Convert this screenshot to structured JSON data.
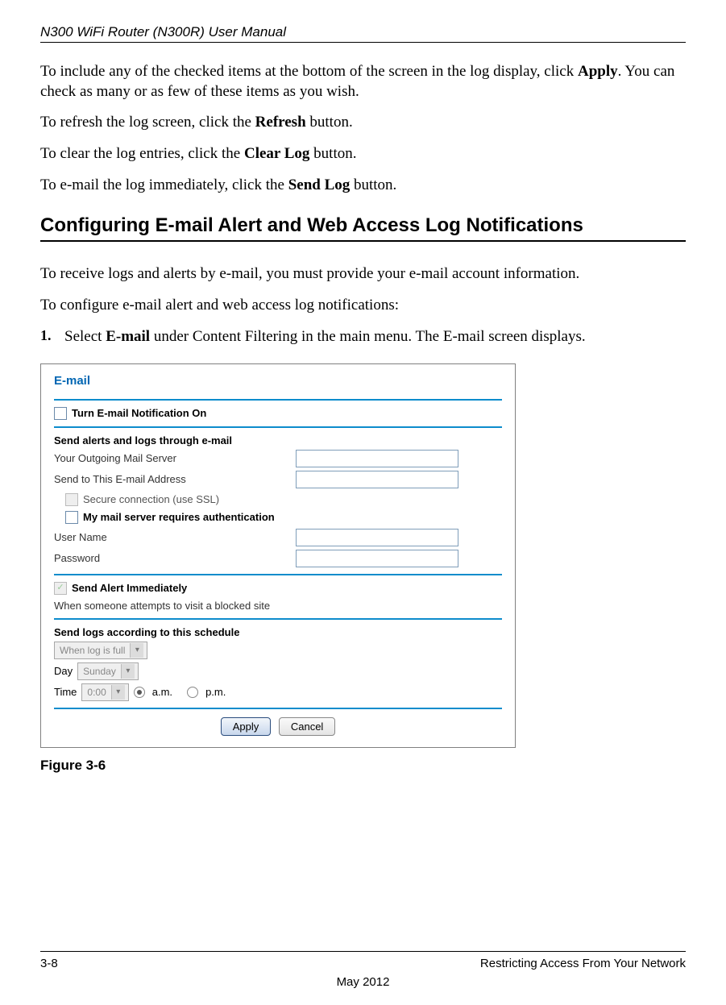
{
  "header": {
    "running_title": "N300 WiFi Router (N300R) User Manual"
  },
  "body": {
    "p1a": "To include any of the checked items at the bottom of the screen in the log display, click ",
    "p1b": "Apply",
    "p1c": ". You can check as many or as few of these items as you wish.",
    "p2a": "To refresh the log screen, click the ",
    "p2b": "Refresh",
    "p2c": " button.",
    "p3a": "To clear the log entries, click the ",
    "p3b": "Clear Log",
    "p3c": " button.",
    "p4a": "To e-mail the log immediately, click the ",
    "p4b": "Send Log",
    "p4c": " button.",
    "section_title": "Configuring E-mail Alert and Web Access Log Notifications",
    "p5": "To receive logs and alerts by e-mail, you must provide your e-mail account information.",
    "p6": "To configure e-mail alert and web access log notifications:",
    "step1_num": "1.",
    "step1a": "Select ",
    "step1b": "E-mail",
    "step1c": " under Content Filtering in the main menu. The E-mail screen displays."
  },
  "router": {
    "title": "E-mail",
    "turn_on": "Turn E-mail Notification On",
    "send_alerts_heading": "Send alerts and logs through e-mail",
    "outgoing_label": "Your Outgoing Mail Server",
    "sendto_label": "Send to This E-mail Address",
    "ssl_label": "Secure connection (use SSL)",
    "auth_label": "My mail server requires authentication",
    "user_label": "User Name",
    "pass_label": "Password",
    "alert_immediate": "Send Alert Immediately",
    "alert_when": "When someone attempts to visit a blocked site",
    "schedule_heading": "Send logs according to this schedule",
    "schedule_select": "When log is full",
    "day_label": "Day",
    "day_value": "Sunday",
    "time_label": "Time",
    "time_value": "0:00",
    "am": "a.m.",
    "pm": "p.m.",
    "apply": "Apply",
    "cancel": "Cancel"
  },
  "figure_caption": "Figure 3-6",
  "footer": {
    "page_num": "3-8",
    "chapter": "Restricting Access From Your Network",
    "date": "May 2012"
  }
}
